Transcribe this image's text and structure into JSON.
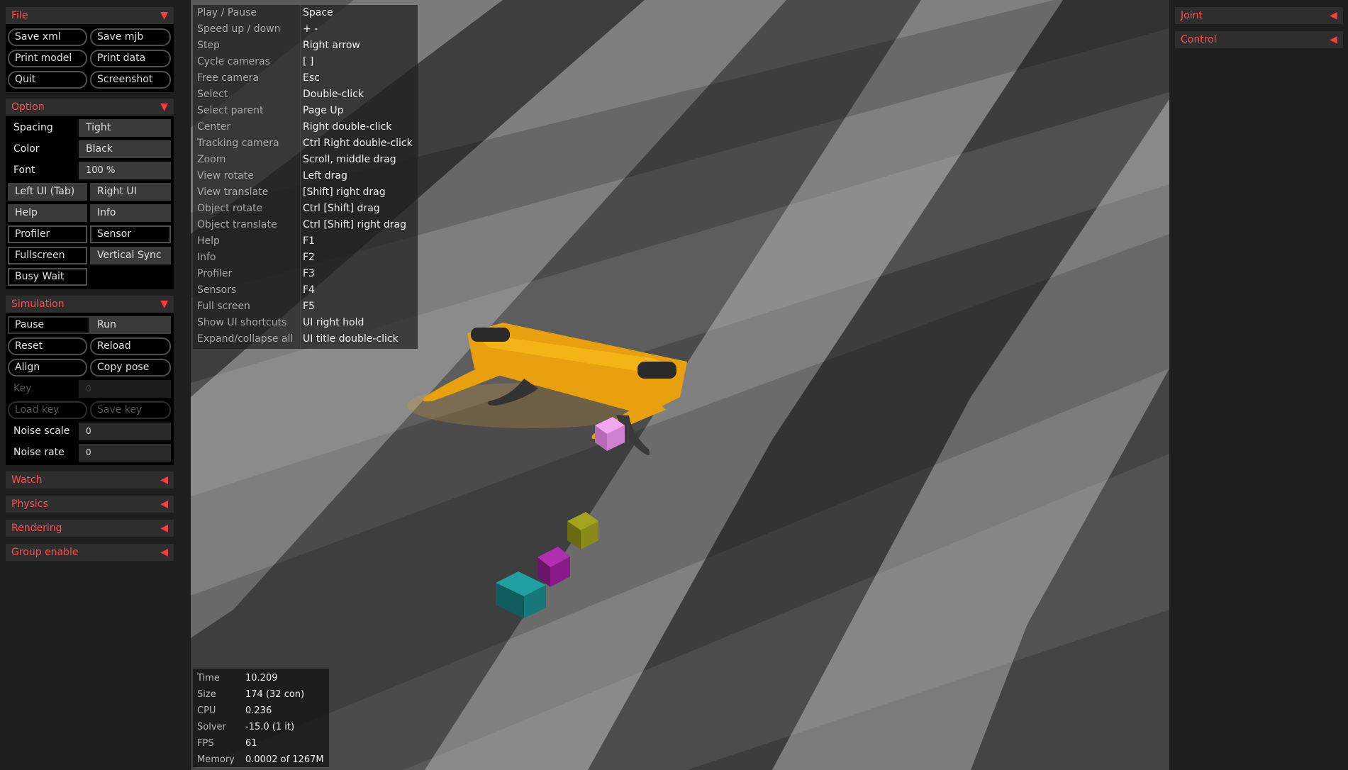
{
  "file": {
    "title": "File",
    "buttons": [
      "Save xml",
      "Save mjb",
      "Print model",
      "Print data",
      "Quit",
      "Screenshot"
    ]
  },
  "option": {
    "title": "Option",
    "spacing_label": "Spacing",
    "spacing_value": "Tight",
    "color_label": "Color",
    "color_value": "Black",
    "font_label": "Font",
    "font_value": "100 %",
    "toggles": [
      "Left UI (Tab)",
      "Right UI",
      "Help",
      "Info",
      "Profiler",
      "Sensor",
      "Fullscreen",
      "Vertical Sync",
      "Busy Wait"
    ]
  },
  "simulation": {
    "title": "Simulation",
    "pause": "Pause",
    "run": "Run",
    "reset": "Reset",
    "reload": "Reload",
    "align": "Align",
    "copy_pose": "Copy pose",
    "key_label": "Key",
    "key_value": "0",
    "load_key": "Load key",
    "save_key": "Save key",
    "noise_scale_label": "Noise scale",
    "noise_scale_value": "0",
    "noise_rate_label": "Noise rate",
    "noise_rate_value": "0"
  },
  "collapsed_sections": [
    "Watch",
    "Physics",
    "Rendering",
    "Group enable"
  ],
  "right_sections": [
    "Joint",
    "Control"
  ],
  "help": [
    [
      "Play / Pause",
      "Space"
    ],
    [
      "Speed up / down",
      "+  -"
    ],
    [
      "Step",
      "Right arrow"
    ],
    [
      "Cycle cameras",
      "[  ]"
    ],
    [
      "Free camera",
      "Esc"
    ],
    [
      "Select",
      "Double-click"
    ],
    [
      "Select parent",
      "Page Up"
    ],
    [
      "Center",
      "Right double-click"
    ],
    [
      "Tracking camera",
      "Ctrl Right double-click"
    ],
    [
      "Zoom",
      "Scroll, middle drag"
    ],
    [
      "View rotate",
      "Left drag"
    ],
    [
      "View translate",
      "[Shift] right drag"
    ],
    [
      "Object rotate",
      "Ctrl [Shift] drag"
    ],
    [
      "Object translate",
      "Ctrl [Shift] right drag"
    ],
    [
      "Help",
      "F1"
    ],
    [
      "Info",
      "F2"
    ],
    [
      "Profiler",
      "F3"
    ],
    [
      "Sensors",
      "F4"
    ],
    [
      "Full screen",
      "F5"
    ],
    [
      "Show UI shortcuts",
      "UI right hold"
    ],
    [
      "Expand/collapse all",
      "UI title double-click"
    ]
  ],
  "info": [
    [
      "Time",
      "10.209"
    ],
    [
      "Size",
      "174  (32 con)"
    ],
    [
      "CPU",
      "0.236"
    ],
    [
      "Solver",
      "-15.0  (1 it)"
    ],
    [
      "FPS",
      "61"
    ],
    [
      "Memory",
      "0.0002 of 1267M"
    ]
  ],
  "colors": {
    "accent": "#ff4d4d",
    "robot": "#e8a00e",
    "floor_light": "#7c7c7c",
    "floor_dark": "#3c3c3c",
    "cube_pink": "#e68fe6",
    "cube_olive": "#8a8a18",
    "cube_magenta": "#9c1f9c",
    "cube_teal": "#1a8a8a"
  }
}
